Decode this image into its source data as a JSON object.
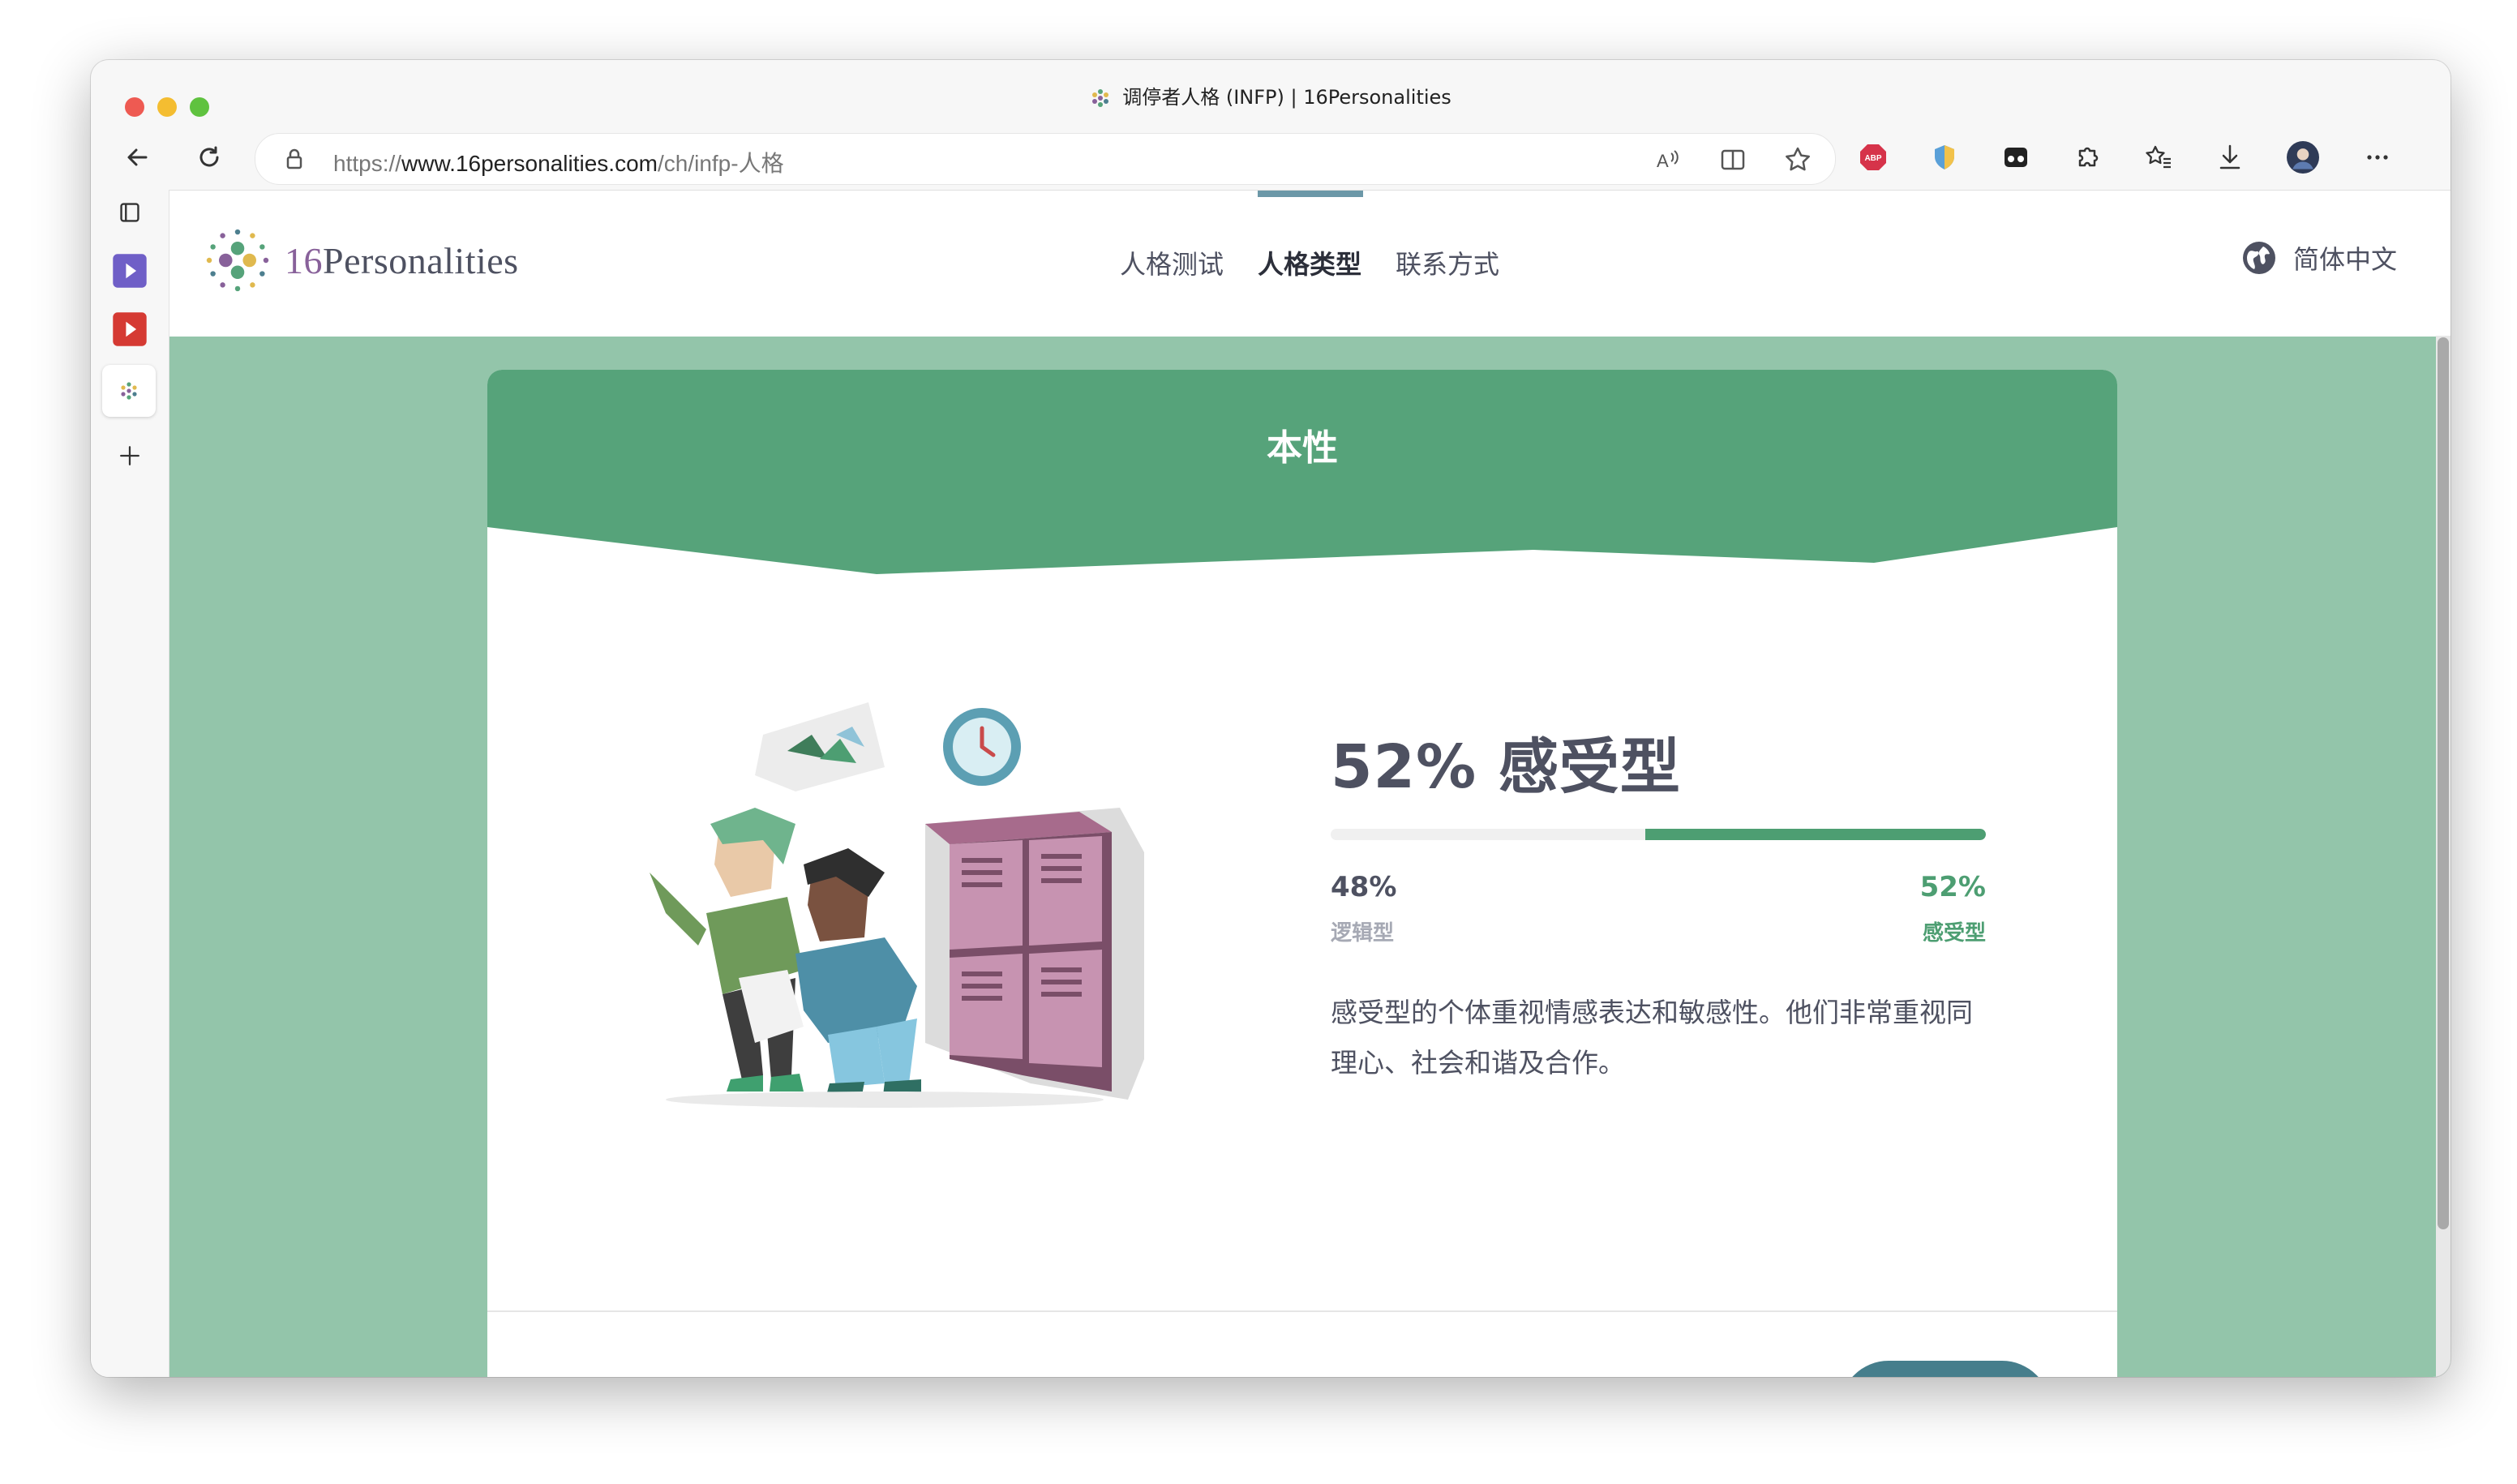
{
  "browser": {
    "tab_title": "调停者人格 (INFP) | 16Personalities",
    "url_scheme": "https://",
    "url_host": "www.16personalities.com",
    "url_path": "/ch/infp-人格",
    "extensions": [
      "abp-icon",
      "shield-extension-icon",
      "glasses-extension-icon",
      "puzzle-icon"
    ],
    "toolbar_icons": [
      "read-aloud-icon",
      "split-screen-icon",
      "favorite-star-icon",
      "favorites-icon",
      "download-icon",
      "profile-avatar",
      "more-icon"
    ]
  },
  "site": {
    "logo_number": "16",
    "logo_word": "Personalities",
    "nav": [
      {
        "label": "人格测试"
      },
      {
        "label": "人格类型"
      },
      {
        "label": "联系方式"
      }
    ],
    "active_nav": "人格类型",
    "language": "简体中文"
  },
  "trait_card": {
    "title": "本性",
    "heading": "52% 感受型",
    "left_percent": "48%",
    "left_label": "逻辑型",
    "right_percent": "52%",
    "right_label": "感受型",
    "right_fraction": 0.52,
    "description": "感受型的个体重视情感表达和敏感性。他们非常重视同理心、社会和谐及合作。"
  },
  "colors": {
    "page_bg": "#93c5aa",
    "header_green": "#56a37a",
    "accent_green": "#4d9e72",
    "text_dark": "#4e5161",
    "label_gray": "#a6a9b4",
    "button_teal": "#467e8c"
  }
}
